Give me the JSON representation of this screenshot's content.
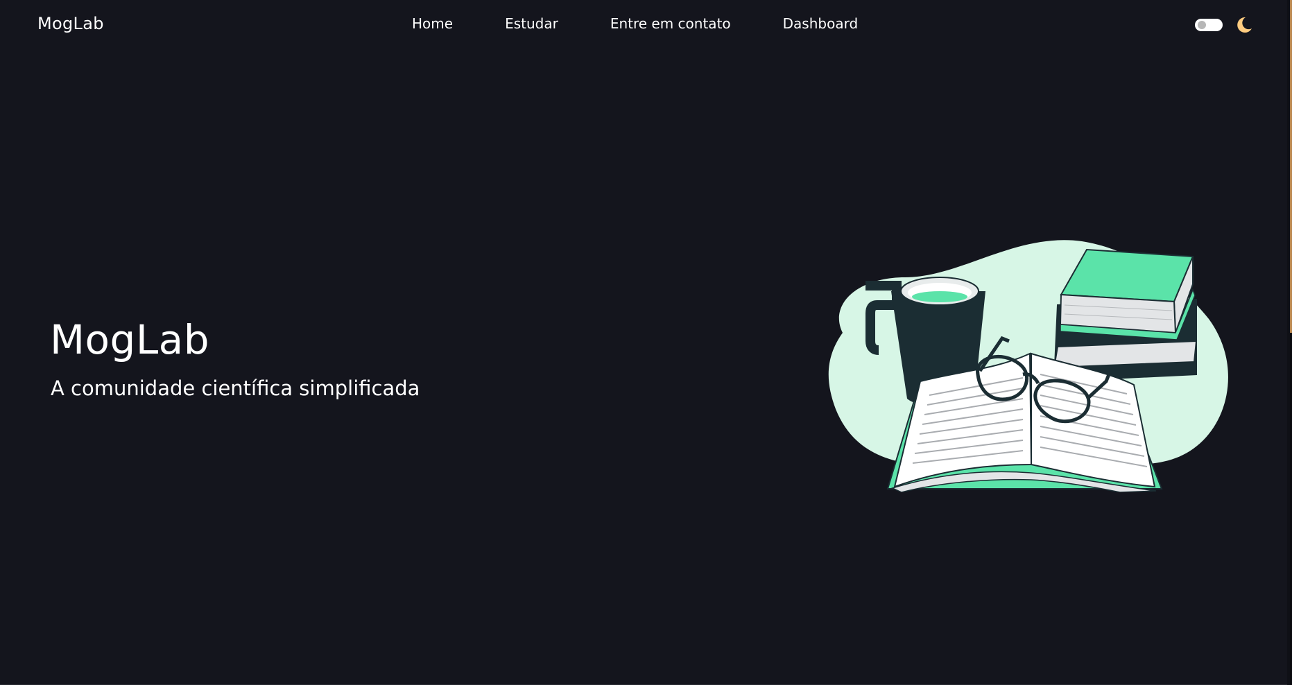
{
  "navbar": {
    "brand": "MogLab",
    "links": [
      {
        "label": "Home"
      },
      {
        "label": "Estudar"
      },
      {
        "label": "Entre em contato"
      },
      {
        "label": "Dashboard"
      }
    ],
    "theme_toggle": {
      "state": "off",
      "icon": "moon-icon"
    }
  },
  "hero": {
    "title": "MogLab",
    "subtitle": "A comunidade científica simplificada",
    "illustration": "books-coffee-glasses-illustration"
  },
  "colors": {
    "background": "#14151d",
    "text": "#ffffff",
    "accent_green": "#5be3a9",
    "blob_mint": "#d7f6e6",
    "moon_yellow": "#ffcc80"
  }
}
